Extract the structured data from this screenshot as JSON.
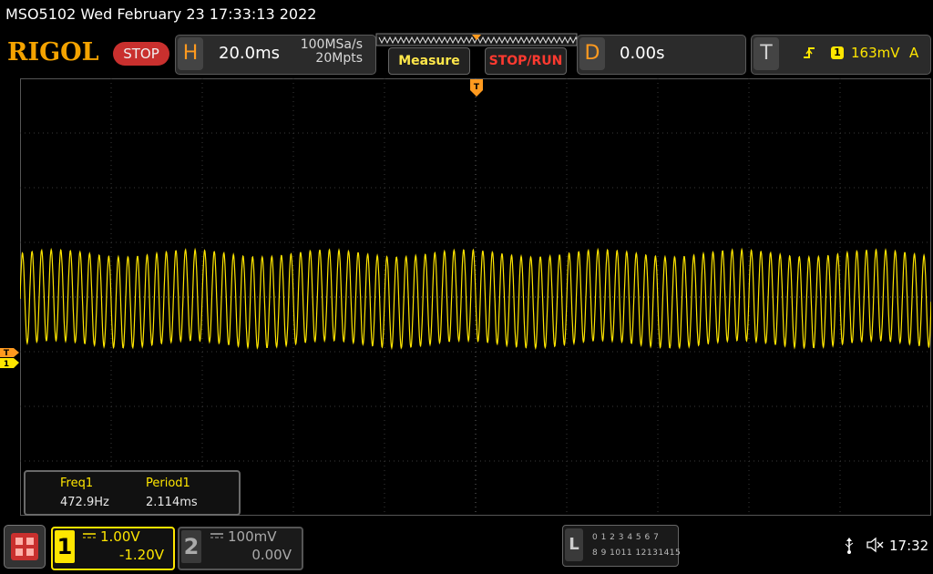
{
  "title_bar": {
    "text": "MSO5102  Wed February 23 17:33:13 2022"
  },
  "header": {
    "logo": "RIGOL",
    "run_state": "STOP",
    "horizontal": {
      "letter": "H",
      "timebase": "20.0ms",
      "sample_rate": "100MSa/s",
      "memory_depth": "20Mpts"
    },
    "measure_label": "Measure",
    "stop_run_label": "STOP/RUN",
    "delay": {
      "letter": "D",
      "value": "0.00s"
    },
    "trigger": {
      "letter": "T",
      "channel": "1",
      "level": "163mV",
      "mode": "A"
    }
  },
  "scope": {
    "trigger_marker": "T",
    "ch1_marker": "1",
    "trace_color": "#ffe600",
    "signal": {
      "frequency": "472.9Hz",
      "period": "2.114ms"
    }
  },
  "measurements": [
    {
      "name": "Freq1",
      "value": "472.9Hz"
    },
    {
      "name": "Period1",
      "value": "2.114ms"
    }
  ],
  "channels": [
    {
      "num": "1",
      "scale": "1.00V",
      "offset": "-1.20V",
      "color": "#ffe600",
      "active": true
    },
    {
      "num": "2",
      "scale": "100mV",
      "offset": "0.00V",
      "color": "#aaaaaa",
      "active": false
    }
  ],
  "logic": {
    "letter": "L",
    "row1": "0 1 2 3  4 5 6 7",
    "row2": "8 9 1011 12131415"
  },
  "status": {
    "clock": "17:32",
    "usb_icon": "usb-icon",
    "speaker_icon": "speaker-muted-icon"
  }
}
